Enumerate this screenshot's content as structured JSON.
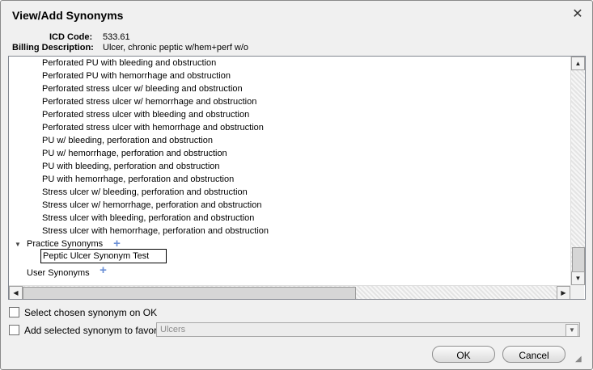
{
  "dialog": {
    "title": "View/Add Synonyms"
  },
  "info": {
    "icd_label": "ICD Code:",
    "icd_value": "533.61",
    "billing_label": "Billing Description:",
    "billing_value": "Ulcer, chronic peptic w/hem+perf w/o"
  },
  "tree": {
    "synonyms": [
      "Perforated PU with bleeding and obstruction",
      "Perforated PU with hemorrhage and obstruction",
      "Perforated stress ulcer w/ bleeding and obstruction",
      "Perforated stress ulcer w/ hemorrhage and obstruction",
      "Perforated stress ulcer with bleeding and obstruction",
      "Perforated stress ulcer with hemorrhage and obstruction",
      "PU w/ bleeding, perforation and obstruction",
      "PU w/ hemorrhage, perforation and obstruction",
      "PU with bleeding, perforation and obstruction",
      "PU with hemorrhage, perforation and obstruction",
      "Stress ulcer w/ bleeding, perforation and obstruction",
      "Stress ulcer w/ hemorrhage, perforation and obstruction",
      "Stress ulcer with bleeding, perforation and obstruction",
      "Stress ulcer with hemorrhage, perforation and obstruction"
    ],
    "practice_group": "Practice Synonyms",
    "practice_edit_value": "Peptic Ulcer Synonym Test",
    "user_group": "User Synonyms"
  },
  "options": {
    "select_chosen_label": "Select chosen synonym on OK",
    "add_favorite_label": "Add selected synonym to favorite:",
    "favorite_value": "Ulcers"
  },
  "buttons": {
    "ok": "OK",
    "cancel": "Cancel"
  }
}
